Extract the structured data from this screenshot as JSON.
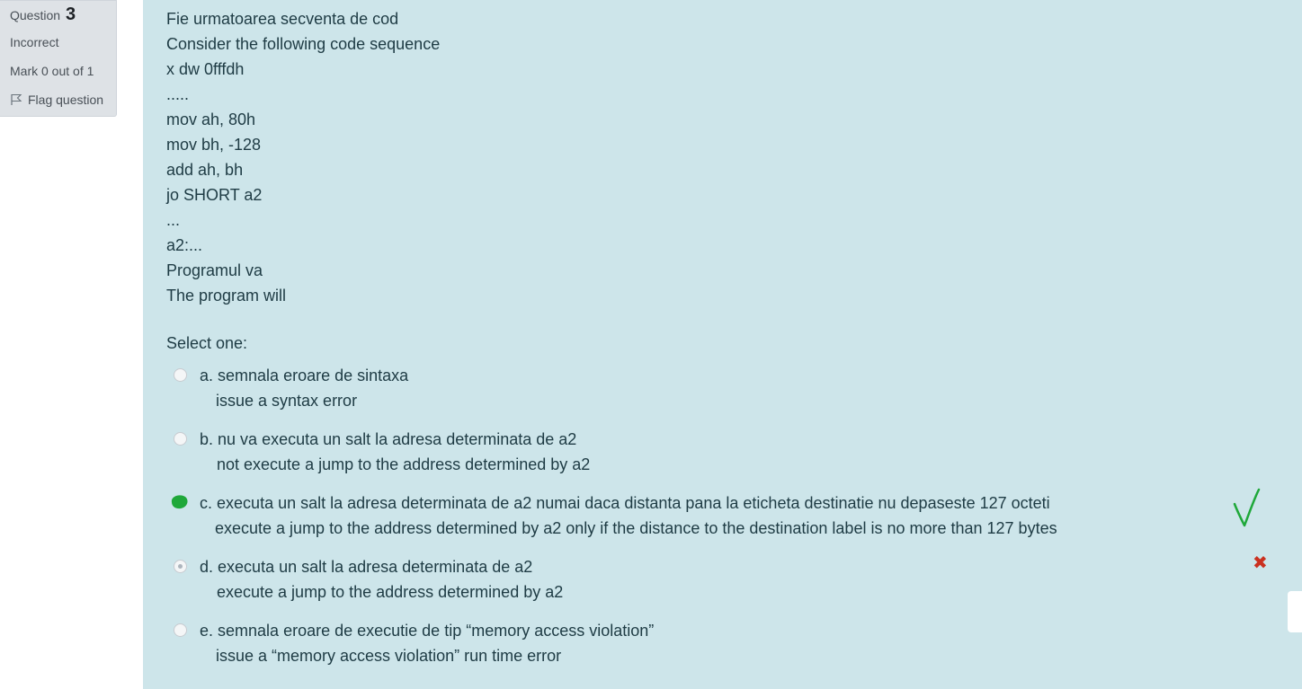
{
  "question_info": {
    "label": "Question",
    "number": "3",
    "state": "Incorrect",
    "grade": "Mark 0 out of 1",
    "flag_label": "Flag question"
  },
  "question_text": [
    "Fie urmatoarea secventa de cod",
    "Consider the following code sequence",
    "x dw 0fffdh",
    ".....",
    "mov ah, 80h",
    "mov bh, -128",
    "add ah, bh",
    "jo SHORT a2",
    "...",
    "a2:...",
    "Programul va",
    "The program will"
  ],
  "prompt": "Select one:",
  "options": [
    {
      "letter": "a.",
      "line1": "semnala eroare de sintaxa",
      "line2": "issue a syntax error",
      "selected": false
    },
    {
      "letter": "b.",
      "line1": "nu va executa un salt la adresa determinata de a2",
      "line2": "not execute a jump to the address determined by a2",
      "selected": false
    },
    {
      "letter": "c.",
      "line1": "executa un salt la adresa determinata de a2 numai daca distanta pana la eticheta destinatie nu depaseste 127 octeti",
      "line2": "execute a jump to the address determined by a2 only if the distance to the destination label is no more than 127 bytes",
      "selected": false,
      "annotated": true
    },
    {
      "letter": "d.",
      "line1": "executa un salt la adresa determinata de a2",
      "line2": "execute a jump to the address determined by a2",
      "selected": true
    },
    {
      "letter": "e.",
      "line1": "semnala eroare de executie de tip “memory access violation”",
      "line2": "issue a “memory access violation” run time error",
      "selected": false
    }
  ],
  "feedback": {
    "incorrect_icon": "cross-icon",
    "handwritten_mark": "check-mark-annotation"
  },
  "colors": {
    "content_bg": "#cde5ea",
    "info_bg": "#dee2e6",
    "text": "#1e3b44",
    "incorrect": "#ca3120",
    "annotation": "#1fa83a"
  }
}
